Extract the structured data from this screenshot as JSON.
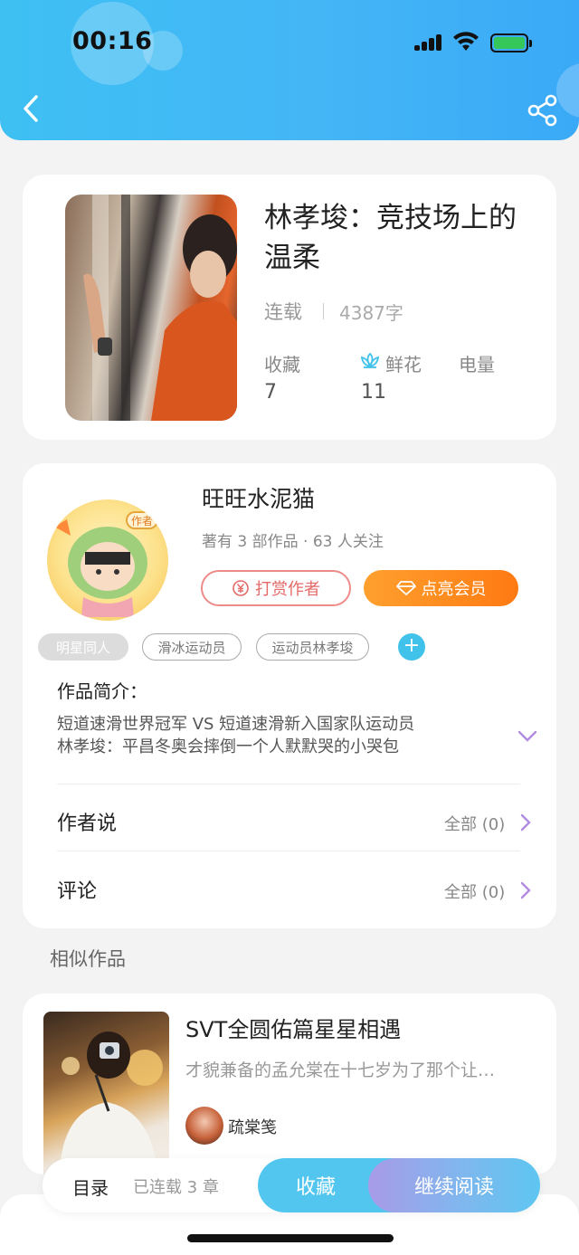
{
  "status_bar": {
    "time": "00:16"
  },
  "book": {
    "title": "林孝埈：竞技场上的温柔",
    "status": "连载",
    "word_count": "4387字",
    "stats": [
      {
        "label": "收藏",
        "value": "7"
      },
      {
        "label": "鲜花",
        "value": "11",
        "icon": "lotus-icon"
      },
      {
        "label": "电量",
        "value": ""
      }
    ]
  },
  "author": {
    "name": "旺旺水泥猫",
    "meta": "著有 3 部作品 · 63 人关注",
    "badge": "作者",
    "reward_label": "打赏作者",
    "vip_label": "点亮会员"
  },
  "tags": [
    "明星同人",
    "滑冰运动员",
    "运动员林孝埈"
  ],
  "intro": {
    "title": "作品简介：",
    "lines": [
      "短道速滑世界冠军 VS 短道速滑新入国家队运动员",
      "林孝埈：平昌冬奥会摔倒一个人默默哭的小哭包"
    ]
  },
  "rows": {
    "author_says": {
      "label": "作者说",
      "right": "全部 (0)"
    },
    "comments": {
      "label": "评论",
      "right": "全部 (0)"
    }
  },
  "similar": {
    "section_title": "相似作品",
    "items": [
      {
        "title": "SVT全圆佑篇星星相遇",
        "desc": "才貌兼备的孟允棠在十七岁为了那个让…",
        "author": "疏棠笺"
      }
    ]
  },
  "action_bar": {
    "toc_label": "目录",
    "chapters": "已连载 3 章",
    "collect_label": "收藏",
    "read_label": "继续阅读"
  },
  "colors": {
    "header": "#3fb9f5",
    "accent_blue": "#41c2ea",
    "vip_orange": "#ff8a1e",
    "reward_red": "#e46a68"
  }
}
